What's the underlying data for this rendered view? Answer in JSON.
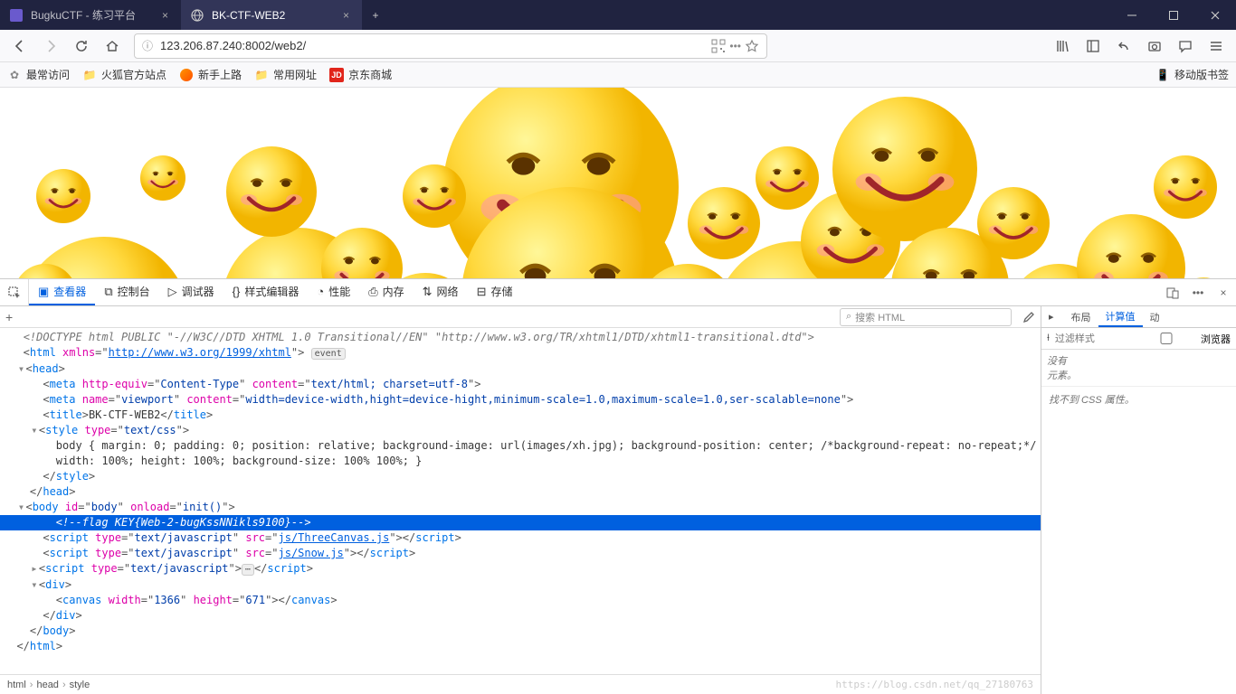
{
  "tabs": [
    {
      "title": "BugkuCTF - 练习平台"
    },
    {
      "title": "BK-CTF-WEB2"
    }
  ],
  "newtab": "+",
  "url": "123.206.87.240:8002/web2/",
  "urlport": ":8002",
  "bookmarks": {
    "b0": "最常访问",
    "b1": "火狐官方站点",
    "b2": "新手上路",
    "b3": "常用网址",
    "b4": "京东商城",
    "jd": "JD",
    "mobile": "移动版书签"
  },
  "devtabs": {
    "inspector": "查看器",
    "console": "控制台",
    "debugger": "调试器",
    "style": "样式编辑器",
    "perf": "性能",
    "memory": "内存",
    "network": "网络",
    "storage": "存储"
  },
  "search_placeholder": "搜索 HTML",
  "rpanel": {
    "layout": "布局",
    "computed": "计算值",
    "changes": "动",
    "filter_placeholder": "过滤样式",
    "browser_chk": "浏览器",
    "noel1": "没有",
    "noel2": "元素。",
    "nocss": "找不到 CSS 属性。"
  },
  "dom": {
    "doctype": "<!DOCTYPE html PUBLIC \"-//W3C//DTD XHTML 1.0 Transitional//EN\" \"http://www.w3.org/TR/xhtml1/DTD/xhtml1-transitional.dtd\">",
    "html_xmlns": "http://www.w3.org/1999/xhtml",
    "event": "event",
    "meta1_attr": "Content-Type",
    "meta1_content": "text/html; charset=utf-8",
    "meta2_name": "viewport",
    "meta2_content": "width=device-width,hight=device-hight,minimum-scale=1.0,maximum-scale=1.0,ser-scalable=none",
    "title_text": "BK-CTF-WEB2",
    "style_type": "text/css",
    "css_body1": "body { margin: 0; padding: 0; position: relative; background-image: url(images/xh.jpg); background-position: center; /*background-repeat: no-repeat;*/",
    "css_body2": "width: 100%; height: 100%; background-size: 100% 100%; }",
    "body_id": "body",
    "body_onload": "init()",
    "flag_comment": "<!--flag KEY{Web-2-bugKssNNikls9100}-->",
    "script1_src": "js/ThreeCanvas.js",
    "script2_src": "js/Snow.js",
    "script_type": "text/javascript",
    "canvas_w": "1366",
    "canvas_h": "671"
  },
  "crumbs": [
    "html",
    "head",
    "style"
  ],
  "watermark": "https://blog.csdn.net/qq_27180763"
}
